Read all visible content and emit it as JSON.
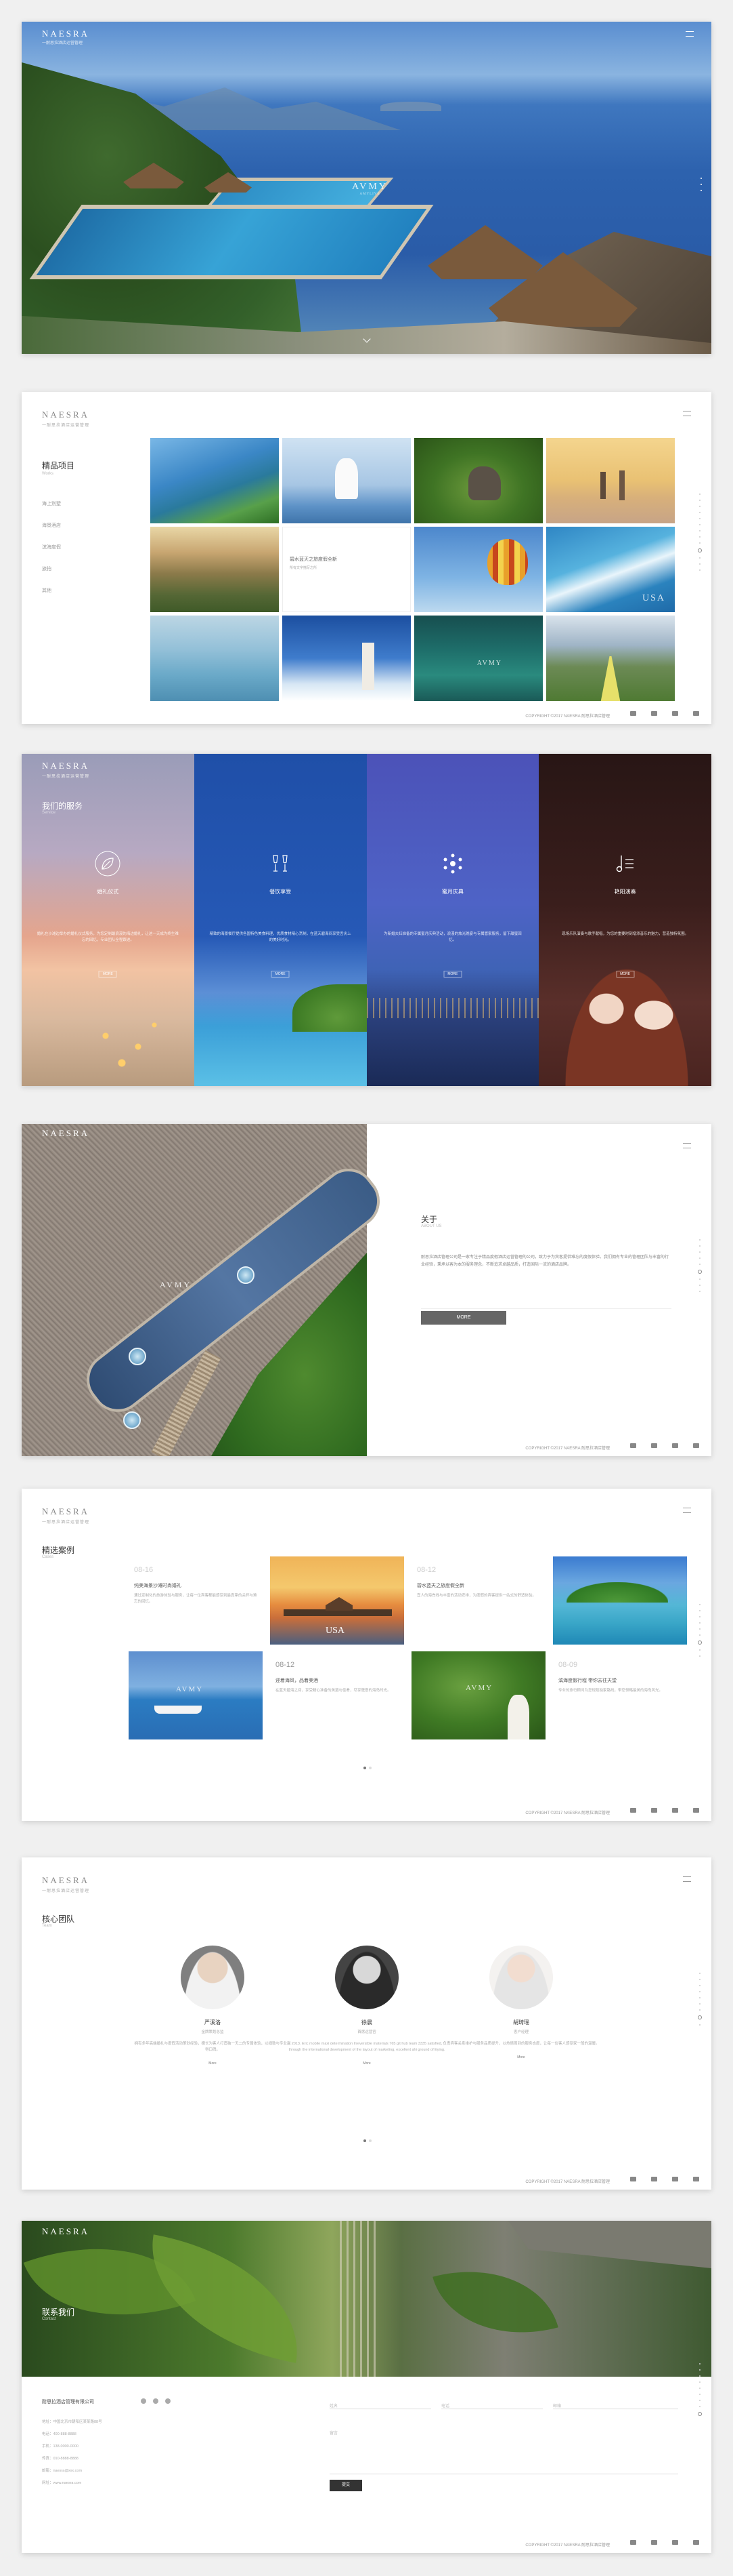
{
  "brand": {
    "name": "NAESRA",
    "sub": "一耐思拉酒店运营管理"
  },
  "hero": {
    "mark": "AVMY",
    "mark_sub": "AMYLIVE"
  },
  "featured": {
    "title": "精品项目",
    "subtitle": "Works",
    "nav": [
      "海上別墅",
      "海景酒店",
      "滨海度假",
      "旅拍",
      "其他"
    ],
    "tile_caption": "碧水蓝天之旅度假全新",
    "tile_caption_sub": "所有文字描写之所",
    "usa_mark": "USA",
    "avmy_mark": "AVMY"
  },
  "services": {
    "heading": "我们的服务",
    "heading_sub": "Service",
    "items": [
      {
        "label": "婚礼仪式",
        "desc": "婚礼在沙滩边举办的婚礼仪式服务，为您定制最浪漫的海边婚礼，让这一天成为终生难忘的回忆，专业团队全程跟进。"
      },
      {
        "label": "餐饮享受",
        "desc": "精致的海景餐厅提供各国特色美食料理，优质食材精心烹制，在蓝天碧海间享受舌尖上的美好时光。"
      },
      {
        "label": "蜜月庆典",
        "desc": "为新婚夫妇准备的专属蜜月庆典活动，浪漫的烛光晚宴与专属管家服务，留下甜蜜回忆。"
      },
      {
        "label": "艳阳演奏",
        "desc": "现场乐队演奏与歌手献唱，为您的重要时刻增添音乐的魅力，营造独特氛围。"
      }
    ],
    "more": "MORE"
  },
  "about": {
    "title": "关于",
    "subtitle": "ABOUT US",
    "text": "耐思拉酒店管理公司是一家专注于精品度假酒店运营管理的公司，致力于为宾客提供难忘的度假体验。我们拥有专业的管理团队与丰富的行业经验，秉承以客为本的服务理念，不断追求卓越品质，打造国际一流的酒店品牌。",
    "more": "MORE",
    "mark": "AVMY"
  },
  "cases": {
    "title": "精选案例",
    "subtitle": "Cases",
    "items": [
      {
        "date": "08-16",
        "title": "纯美海景沙滩时尚婚礼",
        "desc": "通过定制化的旅游体验与服务，让每一位宾客都能感受到最真挚的关怀与难忘的回忆。"
      },
      {
        "date": "08-12",
        "title": "碧水蓝天之旅度假全新",
        "desc": "宜人的海岸线与丰富的活动安排，为度假的宾客提供一站式的舒适体验。"
      },
      {
        "date": "08-12",
        "title": "迎着海风，品着美酒",
        "desc": "在蓝天碧海之间，享受精心准备的美酒与佳肴，尽享惬意的海岛时光。"
      },
      {
        "date": "08-09",
        "title": "滨海度假行程 带你去往天堂",
        "desc": "专业的旅行顾问为您规划独家路线，带您领略最美的海岛风光。"
      }
    ],
    "usa_mark": "USA",
    "avmy_mark": "AVMY"
  },
  "team": {
    "title": "核心团队",
    "subtitle": "Team",
    "members": [
      {
        "name": "严溪洛",
        "role": "金牌策划总监",
        "desc": "拥有多年高端婚礼与度假活动策划经验，擅长为客人打造独一无二的专属体验，以细致与专业赢得口碑。",
        "more": "More"
      },
      {
        "name": "徐晨",
        "role": "首席运营官",
        "desc": "2013. Eric mobile maxi determination Irreversible materials 765 git hub team 3335 satisfied, through the international development of the layout of marketing, excellent ahi ground of Eying.",
        "more": "More"
      },
      {
        "name": "胡琦瑶",
        "role": "客户经理",
        "desc": "负责宾客关系维护与服务品质提升，以热情周到的服务态度，让每一位客人感受家一般的温暖。",
        "more": "More"
      }
    ]
  },
  "contact": {
    "title": "联系我们",
    "subtitle": "Contact",
    "company": "耐思拉酒店管理有限公司",
    "info": [
      "地址：中国北京市朝阳区某某路88号",
      "电话：400-888-8888",
      "手机：138-0000-0000",
      "传真：010-8888-8888",
      "邮箱：naesra@xxx.com",
      "网址：www.naesra.com"
    ],
    "form": {
      "name": "姓名",
      "phone": "电话",
      "email": "邮箱",
      "message": "留言",
      "submit": "提交"
    }
  },
  "footer": {
    "copyright": "COPYRIGHT ©2017 NAESRA 耐思拉酒店管理"
  },
  "colors": {
    "accent": "#666666",
    "ocean": "#2d62ae",
    "deep_blue": "#1f4fa8"
  }
}
